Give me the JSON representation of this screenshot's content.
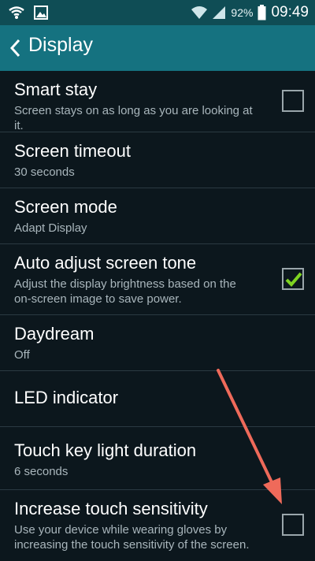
{
  "status": {
    "battery_percent": "92%",
    "time": "09:49"
  },
  "header": {
    "title": "Display"
  },
  "settings": [
    {
      "label": "Smart stay",
      "sub": "Screen stays on as long as you are looking at it.",
      "checked": false
    },
    {
      "label": "Screen timeout",
      "sub": "30 seconds"
    },
    {
      "label": "Screen mode",
      "sub": "Adapt Display"
    },
    {
      "label": "Auto adjust screen tone",
      "sub": "Adjust the display brightness based on the on-screen image to save power.",
      "checked": true
    },
    {
      "label": "Daydream",
      "sub": "Off"
    },
    {
      "label": "LED indicator"
    },
    {
      "label": "Touch key light duration",
      "sub": "6 seconds"
    },
    {
      "label": "Increase touch sensitivity",
      "sub": "Use your device while wearing gloves by increasing the touch sensitivity of the screen.",
      "checked": false
    }
  ],
  "colors": {
    "status_bar": "#0f4d55",
    "action_bar": "#157280",
    "background": "#0c171d",
    "check_green": "#7ed321",
    "annotation_arrow": "#ef6a5a"
  }
}
